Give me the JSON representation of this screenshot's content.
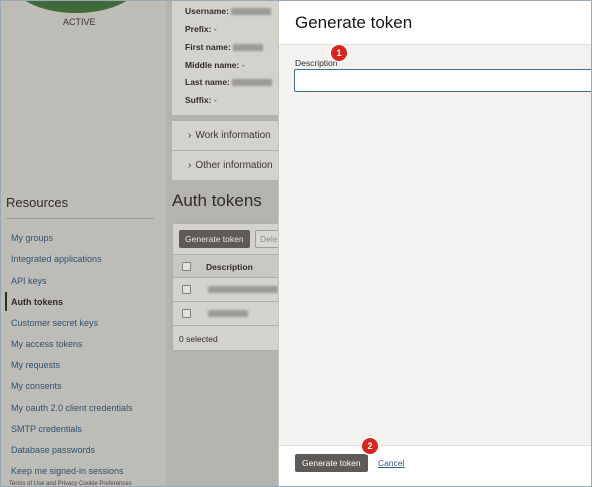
{
  "background": {
    "status": "ACTIVE",
    "profile": [
      {
        "label": "Username:",
        "value": ""
      },
      {
        "label": "Prefix:",
        "value": "-"
      },
      {
        "label": "First name:",
        "value": ""
      },
      {
        "label": "Middle name:",
        "value": "-"
      },
      {
        "label": "Last name:",
        "value": ""
      },
      {
        "label": "Suffix:",
        "value": "-"
      }
    ],
    "sections": [
      "Work information",
      "Other information"
    ],
    "resources_title": "Resources",
    "nav": [
      {
        "label": "My groups",
        "active": false
      },
      {
        "label": "Integrated applications",
        "active": false
      },
      {
        "label": "API keys",
        "active": false
      },
      {
        "label": "Auth tokens",
        "active": true
      },
      {
        "label": "Customer secret keys",
        "active": false
      },
      {
        "label": "My access tokens",
        "active": false
      },
      {
        "label": "My requests",
        "active": false
      },
      {
        "label": "My consents",
        "active": false
      },
      {
        "label": "My oauth 2.0 client credentials",
        "active": false
      },
      {
        "label": "SMTP credentials",
        "active": false
      },
      {
        "label": "Database passwords",
        "active": false
      },
      {
        "label": "Keep me signed-in sessions",
        "active": false
      }
    ],
    "auth_tokens_title": "Auth tokens",
    "generate_token_label": "Generate token",
    "delete_label": "Dele",
    "table_header": "Description",
    "selected_count": "0 selected",
    "footer_text": "Terms of Use and Privacy    Cookie Preferences"
  },
  "drawer": {
    "title": "Generate token",
    "description_label": "Description",
    "description_value": "",
    "submit_label": "Generate token",
    "cancel_label": "Cancel"
  },
  "callouts": [
    "1",
    "2"
  ],
  "colors": {
    "accent": "#d9251c",
    "primary_button": "#5d5a57",
    "link": "#2f5a8a",
    "input_focus": "#3d6e95"
  }
}
